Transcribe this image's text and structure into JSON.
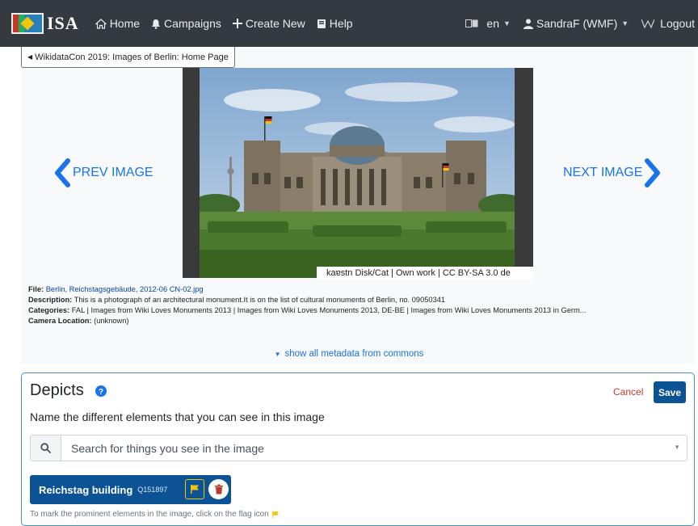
{
  "navbar": {
    "brand": "ISA",
    "items": [
      {
        "label": "Home",
        "icon": "home-icon"
      },
      {
        "label": "Campaigns",
        "icon": "bell-icon"
      },
      {
        "label": "Create New",
        "icon": "plus-icon"
      },
      {
        "label": "Help",
        "icon": "book-icon"
      }
    ],
    "language": "en",
    "user": "SandraF (WMF)",
    "logout": "Logout"
  },
  "breadcrumb": "WikidataCon 2019: Images of Berlin: Home Page",
  "viewer": {
    "prev_label": "PREV IMAGE",
    "next_label": "NEXT IMAGE",
    "credit": "kaɐstn Disk/Cat | Own work | CC BY-SA 3.0 de"
  },
  "metadata": {
    "file_label": "File:",
    "file_value": "Berlin, Reichstagsgebäude, 2012-06 CN-02.jpg",
    "description_label": "Description:",
    "description_value": "This is a photograph of an architectural monument.It is on the list of cultural monuments of Berlin, no. 09050341",
    "categories_label": "Categories:",
    "categories_value": "FAL | Images from Wiki Loves Monuments 2013 | Images from Wiki Loves Monuments 2013, DE-BE | Images from Wiki Loves Monuments 2013 in Germ...",
    "camera_label": "Camera Location:",
    "camera_value": "(unknown)",
    "show_all": "show all metadata from commons"
  },
  "depicts": {
    "title": "Depicts",
    "cancel": "Cancel",
    "save": "Save",
    "subtitle": "Name the different elements that you can see in this image",
    "search_placeholder": "Search for things you see in the image",
    "chip": {
      "label": "Reichstag building",
      "qid": "Q151897"
    },
    "hint": "To mark the prominent elements in the image, click on the flag icon"
  },
  "colors": {
    "navbar": "#343a40",
    "accent_blue": "#0b5394",
    "link_blue": "#1a73e8",
    "cancel_red": "#c0392b",
    "flag_yellow": "#f1c40f"
  }
}
